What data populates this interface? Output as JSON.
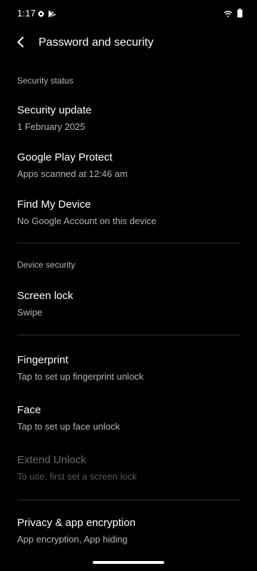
{
  "status_bar": {
    "time": "1:17",
    "left_icons": [
      "gear-icon",
      "play-store-icon"
    ],
    "right_icons": [
      "wifi-icon",
      "battery-icon"
    ]
  },
  "header": {
    "title": "Password and security",
    "back_icon": "chevron-left-icon"
  },
  "sections": {
    "security_status": {
      "label": "Security status"
    },
    "device_security": {
      "label": "Device security"
    }
  },
  "items": {
    "security_update": {
      "title": "Security update",
      "subtitle": "1 February 2025"
    },
    "play_protect": {
      "title": "Google Play Protect",
      "subtitle": "Apps scanned at 12:46 am"
    },
    "find_my_device": {
      "title": "Find My Device",
      "subtitle": "No Google Account on this device"
    },
    "screen_lock": {
      "title": "Screen lock",
      "subtitle": "Swipe"
    },
    "fingerprint": {
      "title": "Fingerprint",
      "subtitle": "Tap to set up fingerprint unlock"
    },
    "face": {
      "title": "Face",
      "subtitle": "Tap to set up face unlock"
    },
    "extend_unlock": {
      "title": "Extend Unlock",
      "subtitle": "To use, first set a screen lock",
      "enabled": false
    },
    "privacy_encryption": {
      "title": "Privacy & app encryption",
      "subtitle": "App encryption, App hiding"
    }
  },
  "colors": {
    "background": "#000000",
    "primary_text": "#ffffff",
    "secondary_text": "#b5b5b5",
    "disabled_text": "#6a6a6a",
    "divider": "#2e2e2e"
  }
}
